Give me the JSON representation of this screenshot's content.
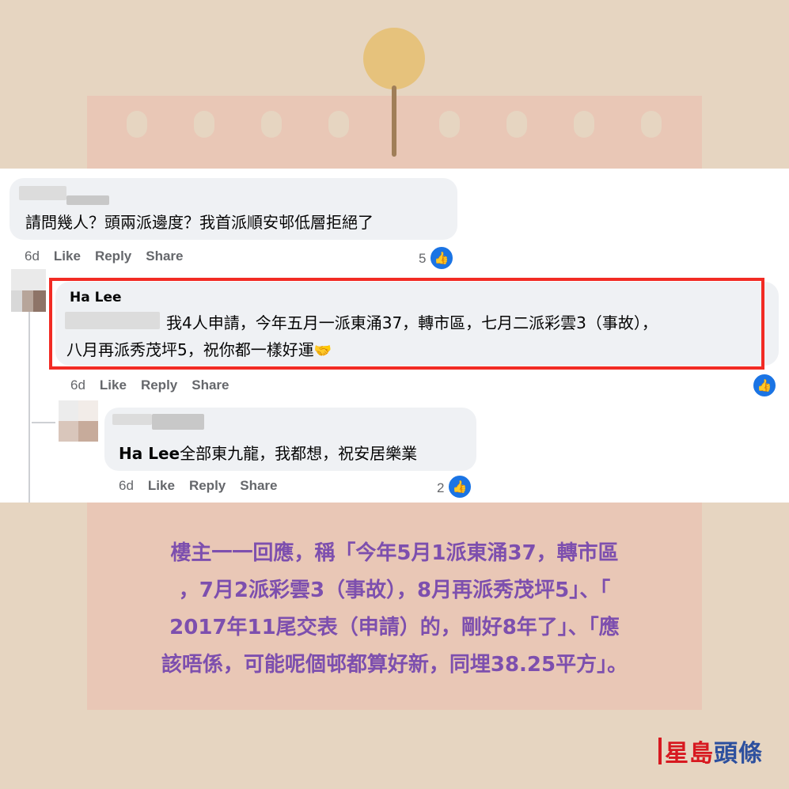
{
  "comments": [
    {
      "text": "請問幾人？頭兩派邊度？我首派順安邨低層拒絕了",
      "actions": {
        "time": "6d",
        "like": "Like",
        "reply": "Reply",
        "share": "Share"
      },
      "like_count": "5"
    },
    {
      "author": "Ha Lee",
      "line1": "我4人申請，今年五月一派東涌37，轉市區，七月二派彩雲3（事故），",
      "line2": "八月再派秀茂坪5，祝你都一樣好運",
      "actions": {
        "time": "6d",
        "like": "Like",
        "reply": "Reply",
        "share": "Share"
      }
    },
    {
      "mention": "Ha Lee",
      "text": "全部東九龍，我都想，祝安居樂業",
      "actions": {
        "time": "6d",
        "like": "Like",
        "reply": "Reply",
        "share": "Share"
      },
      "like_count": "2"
    }
  ],
  "caption": {
    "lines": [
      "樓主一一回應，稱「今年5月1派東涌37，轉市區",
      "，7月2派彩雲3（事故），8月再派秀茂坪5」、「",
      "2017年11尾交表（申請）的，剛好8年了」、「應",
      "該唔係，可能呢個邨都算好新，同埋38.25平方」。"
    ]
  },
  "logo": {
    "text_a": "星島",
    "text_b": "頭條"
  },
  "colors": {
    "highlight": "#f22b24",
    "caption": "#7d4fae",
    "like_blue": "#1b74e4"
  },
  "icons": [
    "like-thumb-icon",
    "handshake-emoji-icon"
  ]
}
